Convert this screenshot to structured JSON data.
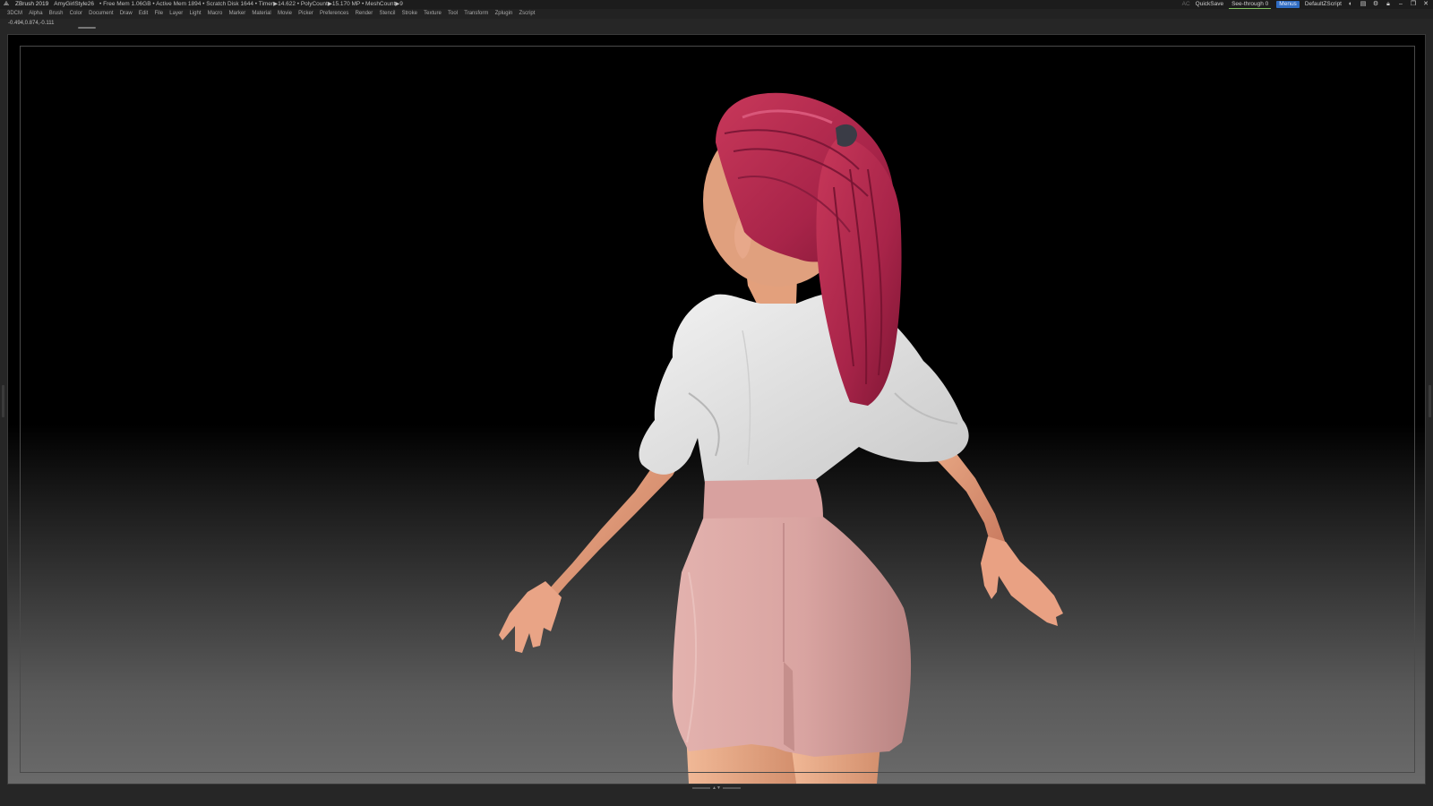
{
  "titlebar": {
    "app_name": "ZBrush 2019",
    "document": "AmyGirlStyle26",
    "stats": "• Free Mem 1.06GB • Active Mem 1894 • Scratch Disk 1644 • Timer▶14.622 • PolyCount▶15.170 MP • MeshCount▶9",
    "ac": "AC",
    "quicksave": "QuickSave",
    "seethrough": "See-through  0",
    "menus": "Menus",
    "default_script": "DefaultZScript"
  },
  "menubar": {
    "items": [
      "3DCM",
      "Alpha",
      "Brush",
      "Color",
      "Document",
      "Draw",
      "Edit",
      "File",
      "Layer",
      "Light",
      "Macro",
      "Marker",
      "Material",
      "Movie",
      "Picker",
      "Preferences",
      "Render",
      "Stencil",
      "Stroke",
      "Texture",
      "Tool",
      "Transform",
      "Zplugin",
      "Zscript"
    ]
  },
  "coords": {
    "value": "-0.494,0.874,-0.111"
  },
  "icons": [
    "app-logo-icon",
    "palette-icon",
    "layout-icon",
    "settings-icon",
    "lock-icon",
    "minimize-icon",
    "restore-icon",
    "close-icon"
  ],
  "colors": {
    "hair": "#b8304f",
    "shirt": "#e6e6e6",
    "skirt": "#d9a5a4",
    "skin": "#e7a57f",
    "accent_blue": "#2f6cc2"
  }
}
